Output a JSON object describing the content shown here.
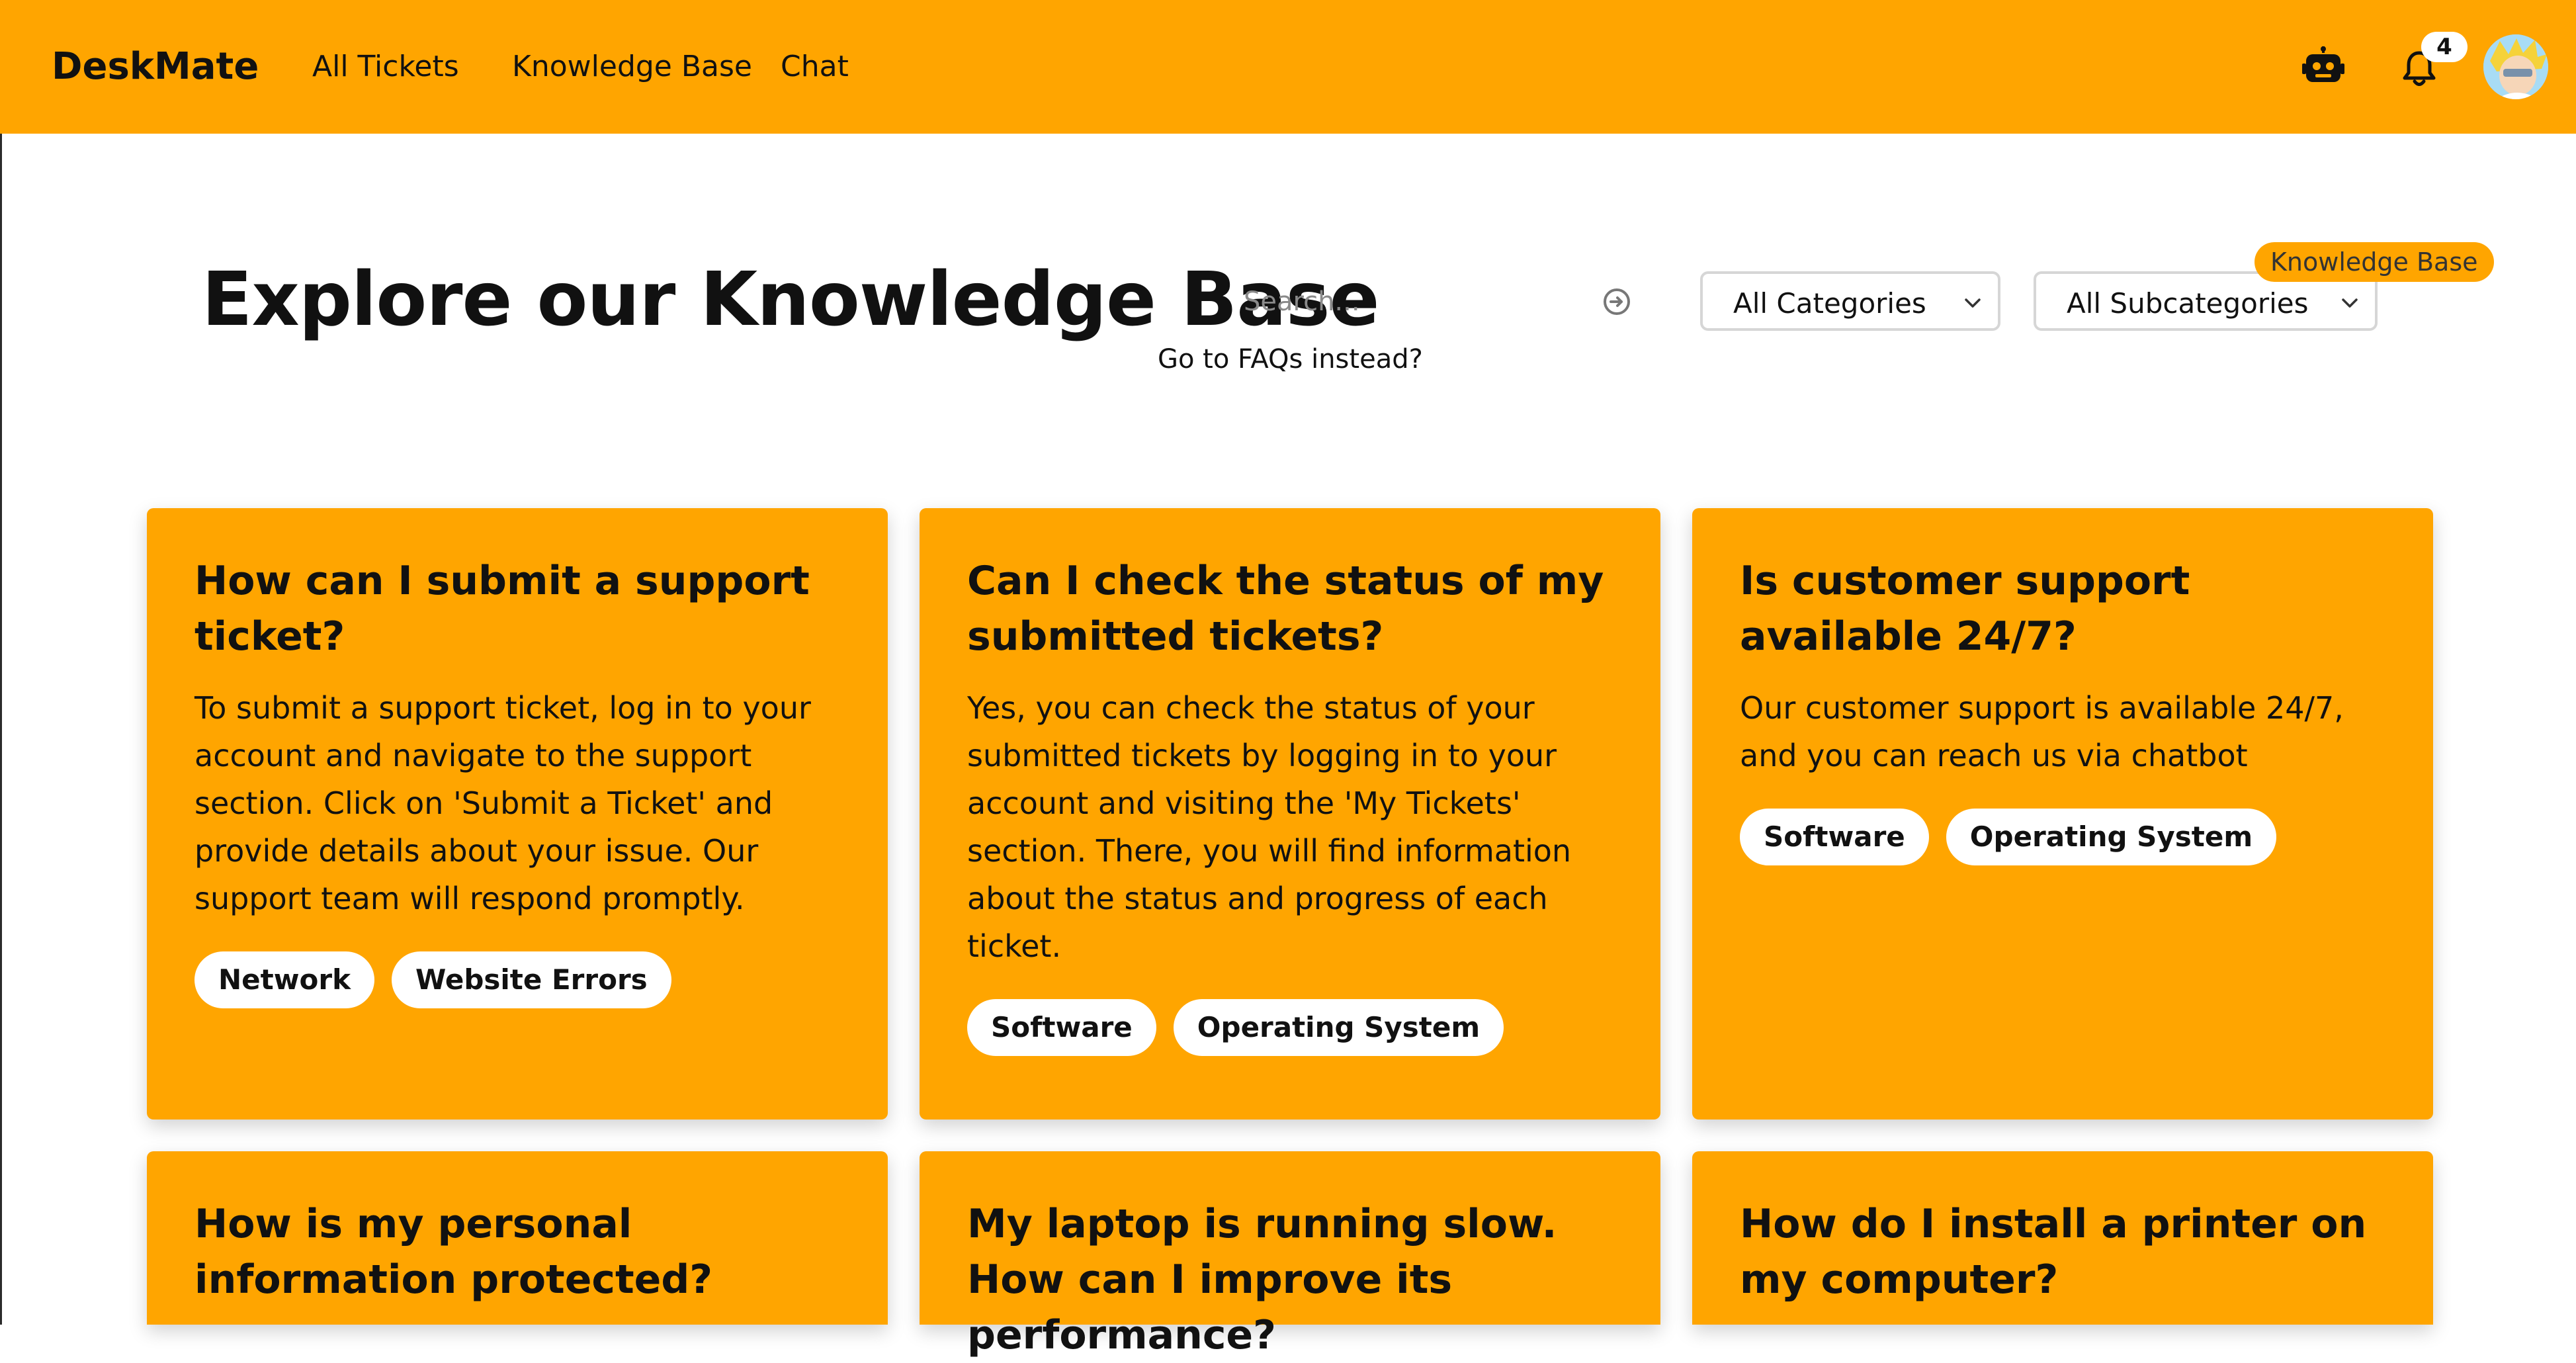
{
  "nav": {
    "brand": "DeskMate",
    "links": [
      "All Tickets",
      "Knowledge Base",
      "Chat"
    ],
    "icons": [
      "robot-icon",
      "bell-icon"
    ],
    "notification_count": "4",
    "accent": "#FFA500"
  },
  "header": {
    "title": "Explore our Knowledge Base",
    "search_placeholder": "Search...",
    "faq_link": "Go to FAQs instead?",
    "category_select": "All Categories",
    "subcategory_select": "All Subcategories",
    "section_pill": "Knowledge Base"
  },
  "cards": [
    {
      "title": "How can I submit a support ticket?",
      "body": "To submit a support ticket, log in to your account and navigate to the support section. Click on 'Submit a Ticket' and provide details about your issue. Our support team will respond promptly.",
      "tags": [
        "Network",
        "Website Errors"
      ]
    },
    {
      "title": "Can I check the status of my submitted tickets?",
      "body": "Yes, you can check the status of your submitted tickets by logging in to your account and visiting the 'My Tickets' section. There, you will find information about the status and progress of each ticket.",
      "tags": [
        "Software",
        "Operating System"
      ]
    },
    {
      "title": "Is customer support available 24/7?",
      "body": "Our customer support is available 24/7, and you can reach us via chatbot",
      "tags": [
        "Software",
        "Operating System"
      ]
    },
    {
      "title": "How is my personal information protected?"
    },
    {
      "title": "My laptop is running slow. How can I improve its performance?"
    },
    {
      "title": "How do I install a printer on my computer?"
    }
  ]
}
